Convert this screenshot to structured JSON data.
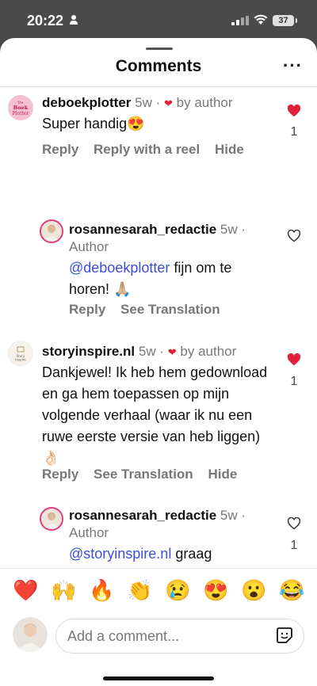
{
  "status_bar": {
    "time": "20:22",
    "battery": "37"
  },
  "header": {
    "title": "Comments"
  },
  "comments": [
    {
      "username": "deboekplotter",
      "age": "5w",
      "dot": "·",
      "liked_by": "by author",
      "avatar_text": [
        "De",
        "Boek",
        "Plotter"
      ],
      "text": "Super handig😍",
      "actions": [
        "Reply",
        "Reply with a reel",
        "Hide"
      ],
      "likes": "1",
      "liked": true
    },
    {
      "username": "rosannesarah_redactie",
      "age": "5w",
      "dot": "·",
      "author_label": "Author",
      "mention": "@deboekplotter",
      "text": " fijn om te horen! 🙏🏼",
      "actions": [
        "Reply",
        "See Translation"
      ],
      "likes": "",
      "liked": false
    },
    {
      "username": "storyinspire.nl",
      "age": "5w",
      "dot": "·",
      "liked_by": "by author",
      "avatar_text": [
        "Story",
        "Inspire"
      ],
      "text": "Dankjewel! Ik heb hem gedownload en ga hem toepassen op mijn volgende verhaal (waar ik nu een ruwe eerste versie van heb liggen) 👌🏻",
      "actions": [
        "Reply",
        "See Translation",
        "Hide"
      ],
      "likes": "1",
      "liked": true
    },
    {
      "username": "rosannesarah_redactie",
      "age": "5w",
      "dot": "·",
      "author_label": "Author",
      "mention": "@storyinspire.nl",
      "text": " graag gedaan! Wat goed! Veel succes!",
      "actions": [],
      "likes": "1",
      "liked": false
    }
  ],
  "reactions": [
    "❤️",
    "🙌",
    "🔥",
    "👏",
    "😢",
    "😍",
    "😮",
    "😂"
  ],
  "composer": {
    "placeholder": "Add a comment..."
  },
  "colors": {
    "like_red": "#e0213a",
    "mention_blue": "#3b4fd6",
    "muted": "#777777"
  }
}
